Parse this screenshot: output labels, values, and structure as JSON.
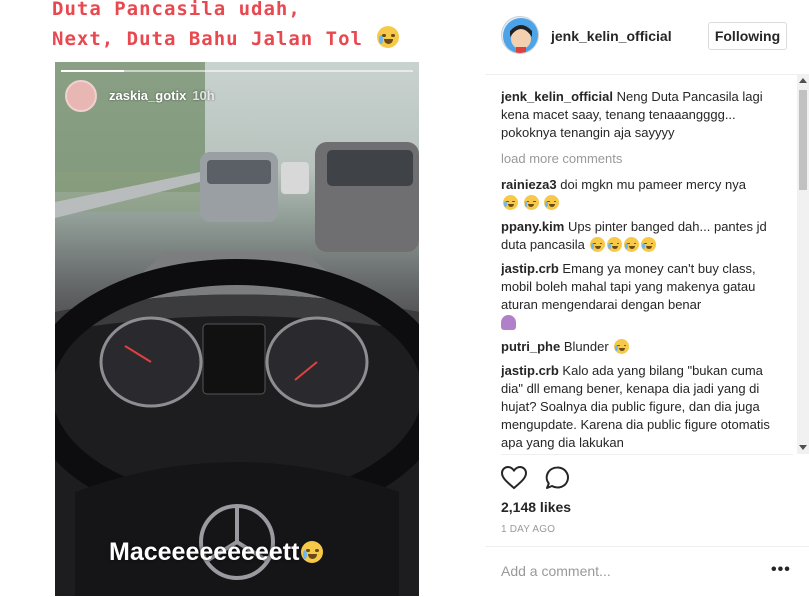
{
  "media": {
    "caption_line1": "Duta Pancasila udah,",
    "caption_line2": "Next, Duta Bahu Jalan Tol",
    "story_user": "zaskia_gotix",
    "story_time": "10h",
    "story_text": "Maceeeeeeeeett"
  },
  "post": {
    "username": "jenk_kelin_official",
    "follow_label": "Following",
    "caption_user": "jenk_kelin_official",
    "caption_text": "Neng Duta Pancasila lagi kena macet saay, tenang tenaaangggg... pokoknya tenangin aja sayyyy",
    "load_more": "load more comments",
    "comments": [
      {
        "user": "rainieza3",
        "text": "doi mgkn mu pameer mercy nya"
      },
      {
        "user": "ppany.kim",
        "text": "Ups pinter banged dah... pantes jd duta pancasila"
      },
      {
        "user": "jastip.crb",
        "text": "Emang ya money can't buy class, mobil boleh mahal tapi yang makenya gatau aturan mengendarai dengan benar"
      },
      {
        "user": "putri_phe",
        "text": "Blunder"
      },
      {
        "user": "jastip.crb",
        "text": "Kalo ada yang bilang \"bukan cuma dia\" dll emang bener, kenapa dia jadi yang di hujat? Soalnya dia public figure, dan dia juga mengupdate. Karena dia public figure otomatis apa yang dia lakukan"
      }
    ],
    "likes": "2,148 likes",
    "time_ago": "1 DAY AGO",
    "comment_placeholder": "Add a comment...",
    "more_label": "•••"
  },
  "icons": {
    "like": "heart-icon",
    "comment": "comment-icon",
    "more": "more-options-icon"
  },
  "colors": {
    "caption_red": "#e8484f",
    "text": "#262626",
    "muted": "#999999"
  }
}
